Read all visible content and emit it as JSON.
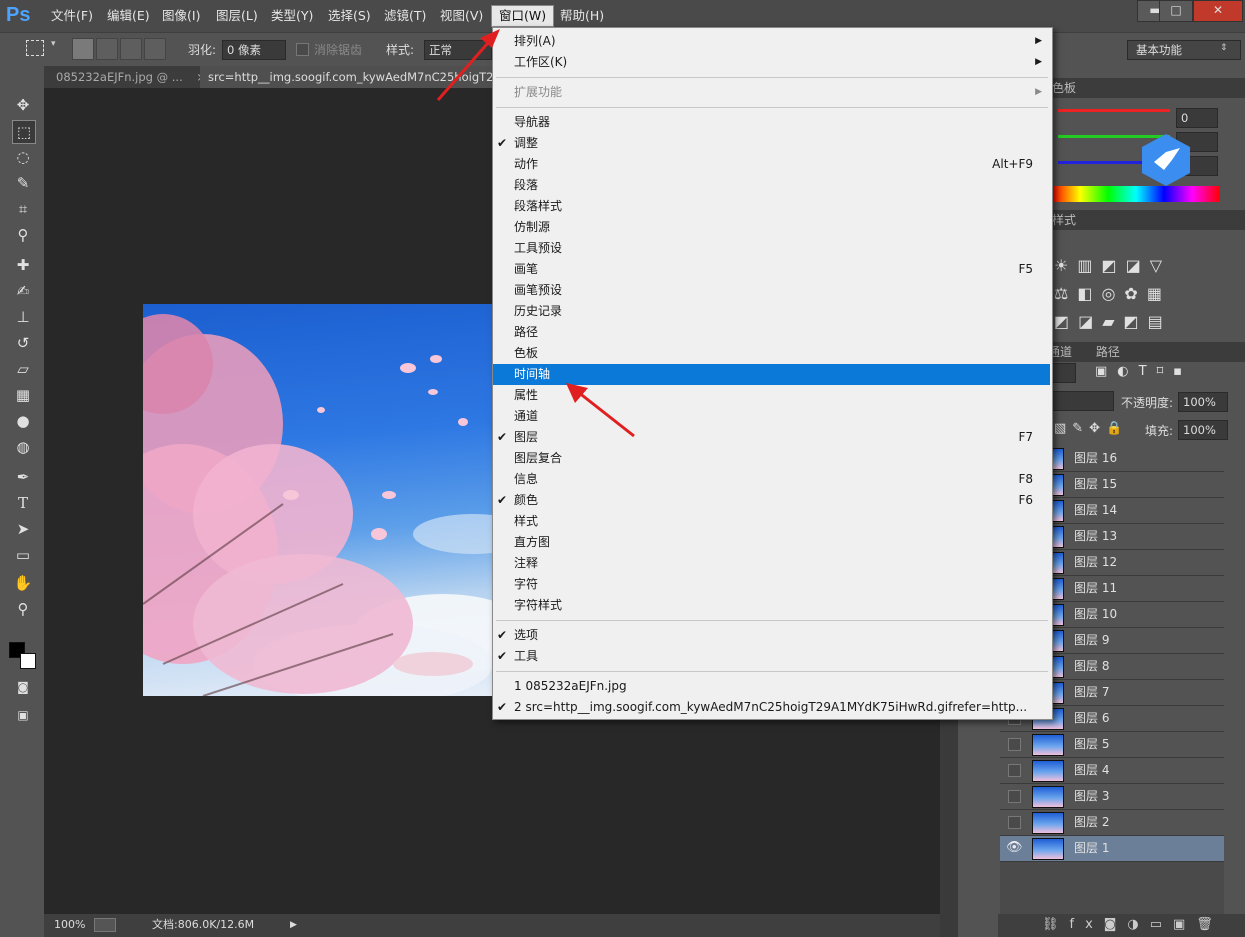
{
  "app": {
    "logo": "Ps"
  },
  "menubar": {
    "items": [
      "文件(F)",
      "编辑(E)",
      "图像(I)",
      "图层(L)",
      "类型(Y)",
      "选择(S)",
      "滤镜(T)",
      "视图(V)",
      "窗口(W)",
      "帮助(H)"
    ],
    "active": "窗口(W)"
  },
  "window_controls": {
    "minimize": "▬",
    "maximize": "□",
    "close": "✕"
  },
  "options_bar": {
    "feather_label": "羽化:",
    "feather_value": "0 像素",
    "antialias_label": "消除锯齿",
    "style_label": "样式:",
    "style_value": "正常",
    "workspace": "基本功能"
  },
  "tabs": [
    {
      "label": "085232aEJFn.jpg @ ...",
      "close": "×"
    },
    {
      "label": "src=http__img.soogif.com_kywAedM7nC25hoigT29A"
    }
  ],
  "window_menu": {
    "items": [
      {
        "label": "排列(A)",
        "submenu": true
      },
      {
        "label": "工作区(K)",
        "submenu": true
      },
      {
        "sep": true
      },
      {
        "label": "扩展功能",
        "submenu": true,
        "disabled": true
      },
      {
        "sep": true
      },
      {
        "label": "导航器"
      },
      {
        "label": "调整",
        "checked": true
      },
      {
        "label": "动作",
        "shortcut": "Alt+F9"
      },
      {
        "label": "段落"
      },
      {
        "label": "段落样式"
      },
      {
        "label": "仿制源"
      },
      {
        "label": "工具预设"
      },
      {
        "label": "画笔",
        "shortcut": "F5"
      },
      {
        "label": "画笔预设"
      },
      {
        "label": "历史记录"
      },
      {
        "label": "路径"
      },
      {
        "label": "色板"
      },
      {
        "label": "时间轴",
        "highlighted": true
      },
      {
        "label": "属性"
      },
      {
        "label": "通道"
      },
      {
        "label": "图层",
        "checked": true,
        "shortcut": "F7"
      },
      {
        "label": "图层复合"
      },
      {
        "label": "信息",
        "shortcut": "F8"
      },
      {
        "label": "颜色",
        "checked": true,
        "shortcut": "F6"
      },
      {
        "label": "样式"
      },
      {
        "label": "直方图"
      },
      {
        "label": "注释"
      },
      {
        "label": "字符"
      },
      {
        "label": "字符样式"
      },
      {
        "sep": true
      },
      {
        "label": "选项",
        "checked": true
      },
      {
        "label": "工具",
        "checked": true
      },
      {
        "sep": true
      },
      {
        "label": "1 085232aEJFn.jpg"
      },
      {
        "label": "2 src=http__img.soogif.com_kywAedM7nC25hoigT29A1MYdK75iHwRd.gifrefer=http...",
        "checked": true
      }
    ]
  },
  "color_panel": {
    "tab_fragment": "色板",
    "r_value": "0"
  },
  "adjust_panel": {
    "tab_fragment": "样式"
  },
  "layers_panel": {
    "tabs": [
      "通道",
      "路径"
    ],
    "opacity_label": "不透明度:",
    "opacity_value": "100%",
    "fill_label": "填充:",
    "fill_value": "100%",
    "layers": [
      "图层 16",
      "图层 15",
      "图层 14",
      "图层 13",
      "图层 12",
      "图层 11",
      "图层 10",
      "图层 9",
      "图层 8",
      "图层 7",
      "图层 6",
      "图层 5",
      "图层 4",
      "图层 3",
      "图层 2",
      "图层 1"
    ],
    "selected": "图层 1"
  },
  "status": {
    "zoom": "100%",
    "doc": "文档:806.0K/12.6M"
  },
  "colors": {
    "accent": "#0a79d8",
    "arrow": "#e02020"
  }
}
